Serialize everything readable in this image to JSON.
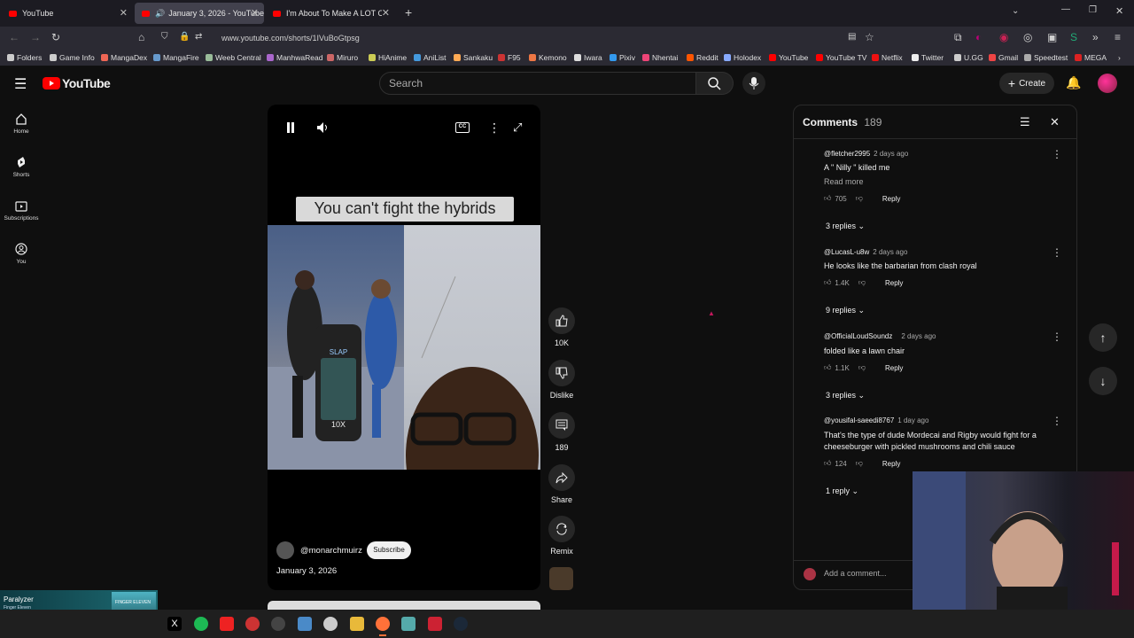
{
  "browser": {
    "tabs": [
      {
        "title": "YouTube"
      },
      {
        "title": "January 3, 2026 - YouTube"
      },
      {
        "title": "I'm About To Make A LOT Of Pe"
      }
    ],
    "url": "www.youtube.com/shorts/1IVuBoGtpsg",
    "bookmarks": [
      "Folders",
      "Game Info",
      "MangaDex",
      "MangaFire",
      "Weeb Central",
      "ManhwaRead",
      "Miruro",
      "HiAnime",
      "AniList",
      "Sankaku",
      "F95",
      "Kemono",
      "Iwara",
      "Pixiv",
      "Nhentai",
      "Reddit",
      "Holodex",
      "YouTube",
      "YouTube TV",
      "Netflix",
      "Twitter",
      "U.GG",
      "Gmail",
      "Speedtest",
      "MEGA"
    ]
  },
  "youtube": {
    "logo": "YouTube",
    "search_placeholder": "Search",
    "create_label": "Create",
    "sidebar": [
      {
        "label": "Home",
        "icon": "home-icon"
      },
      {
        "label": "Shorts",
        "icon": "shorts-icon"
      },
      {
        "label": "Subscriptions",
        "icon": "subscriptions-icon"
      },
      {
        "label": "You",
        "icon": "account-icon"
      }
    ]
  },
  "short": {
    "caption": "You can't fight the hybrids",
    "channel": "@monarchmuirz",
    "subscribe_label": "Subscribe",
    "date": "January 3, 2026",
    "actions": {
      "like_count": "10K",
      "dislike_label": "Dislike",
      "comment_count": "189",
      "share_label": "Share",
      "remix_label": "Remix"
    }
  },
  "comments": {
    "title": "Comments",
    "count": "189",
    "add_placeholder": "Add a comment...",
    "items": [
      {
        "user": "@fletcher2995",
        "time": "2 days ago",
        "text": "A \" Nilly \" killed me",
        "read_more": "Read more",
        "likes": "705",
        "reply_label": "Reply",
        "replies": "3 replies"
      },
      {
        "user": "@LucasL-u8w",
        "time": "2 days ago",
        "text": "He looks like the barbarian from clash royal",
        "likes": "1.4K",
        "reply_label": "Reply",
        "replies": "9 replies"
      },
      {
        "user": "@OfficialLoudSoundz",
        "time": "2 days ago",
        "text": "folded like a lawn chair",
        "likes": "1.1K",
        "reply_label": "Reply",
        "replies": "3 replies"
      },
      {
        "user": "@yousifal-saeedi8767",
        "time": "1 day ago",
        "text": "That's the type of dude Mordecai and Rigby would fight for a cheeseburger with pickled mushrooms and chili sauce",
        "likes": "124",
        "reply_label": "Reply",
        "replies": "1 reply"
      }
    ]
  },
  "music_widget": {
    "title": "Paralyzer",
    "artist": "Finger Eleven",
    "badge": "FINGER ELEVEN"
  },
  "colors": {
    "yt_red": "#ff0000",
    "background": "#0f0f0f",
    "panel_border": "#2a2a2a"
  }
}
